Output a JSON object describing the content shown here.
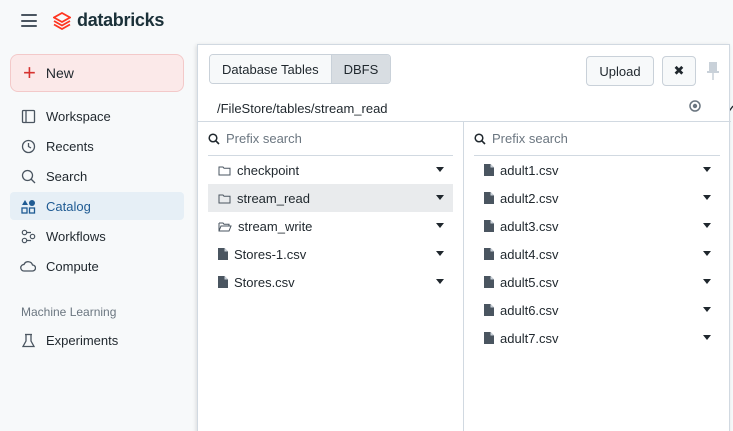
{
  "app": {
    "brand": "databricks",
    "brand_color": "#ff3621",
    "accent": "#1f5b93"
  },
  "sidebar": {
    "new_label": "New",
    "items": [
      {
        "label": "Workspace",
        "icon": "workspace-icon"
      },
      {
        "label": "Recents",
        "icon": "clock-icon"
      },
      {
        "label": "Search",
        "icon": "search-icon"
      },
      {
        "label": "Catalog",
        "icon": "catalog-icon",
        "active": true
      },
      {
        "label": "Workflows",
        "icon": "workflows-icon"
      },
      {
        "label": "Compute",
        "icon": "cloud-icon"
      }
    ],
    "section_ml": "Machine Learning",
    "ml_items": [
      {
        "label": "Experiments",
        "icon": "flask-icon"
      }
    ]
  },
  "dialog": {
    "tabs": [
      {
        "label": "Database Tables"
      },
      {
        "label": "DBFS",
        "selected": true
      }
    ],
    "upload_label": "Upload",
    "close_label": "✖",
    "path": "/FileStore/tables/stream_read",
    "left": {
      "search_placeholder": "Prefix search",
      "items": [
        {
          "label": "checkpoint",
          "type": "folder"
        },
        {
          "label": "stream_read",
          "type": "folder",
          "selected": true
        },
        {
          "label": "stream_write",
          "type": "folder-open"
        },
        {
          "label": "Stores-1.csv",
          "type": "file"
        },
        {
          "label": "Stores.csv",
          "type": "file"
        }
      ]
    },
    "right": {
      "search_placeholder": "Prefix search",
      "items": [
        {
          "label": "adult1.csv",
          "type": "file"
        },
        {
          "label": "adult2.csv",
          "type": "file"
        },
        {
          "label": "adult3.csv",
          "type": "file"
        },
        {
          "label": "adult4.csv",
          "type": "file"
        },
        {
          "label": "adult5.csv",
          "type": "file"
        },
        {
          "label": "adult6.csv",
          "type": "file"
        },
        {
          "label": "adult7.csv",
          "type": "file"
        }
      ]
    }
  }
}
